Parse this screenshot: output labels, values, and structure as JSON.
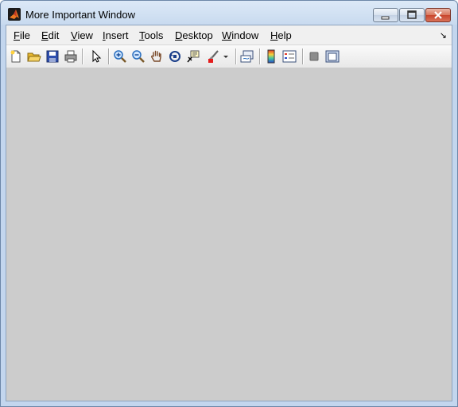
{
  "window": {
    "title": "More Important Window",
    "icons": {
      "app": "matlab-logo-icon",
      "minimize": "minimize-icon",
      "maximize": "maximize-icon",
      "close": "close-icon"
    }
  },
  "menubar": {
    "items": [
      {
        "mnemonic": "F",
        "rest": "ile"
      },
      {
        "mnemonic": "E",
        "rest": "dit"
      },
      {
        "mnemonic": "V",
        "rest": "iew"
      },
      {
        "mnemonic": "I",
        "rest": "nsert"
      },
      {
        "mnemonic": "T",
        "rest": "ools"
      },
      {
        "mnemonic": "D",
        "rest": "esktop"
      },
      {
        "mnemonic": "W",
        "rest": "indow"
      },
      {
        "mnemonic": "H",
        "rest": "elp"
      }
    ],
    "dock_arrow": "↘"
  },
  "toolbar": {
    "icons": [
      "new-figure-icon",
      "open-file-icon",
      "save-icon",
      "print-icon",
      "select-arrow-icon",
      "zoom-in-icon",
      "zoom-out-icon",
      "pan-hand-icon",
      "rotate-3d-icon",
      "data-cursor-icon",
      "brush-icon",
      "brush-dropdown-icon",
      "link-plot-icon",
      "colorbar-icon",
      "legend-icon",
      "hide-plot-tools-icon",
      "show-plot-tools-icon"
    ]
  },
  "colors": {
    "figure_background": "#cccccc",
    "close_button": "#c8452c"
  }
}
